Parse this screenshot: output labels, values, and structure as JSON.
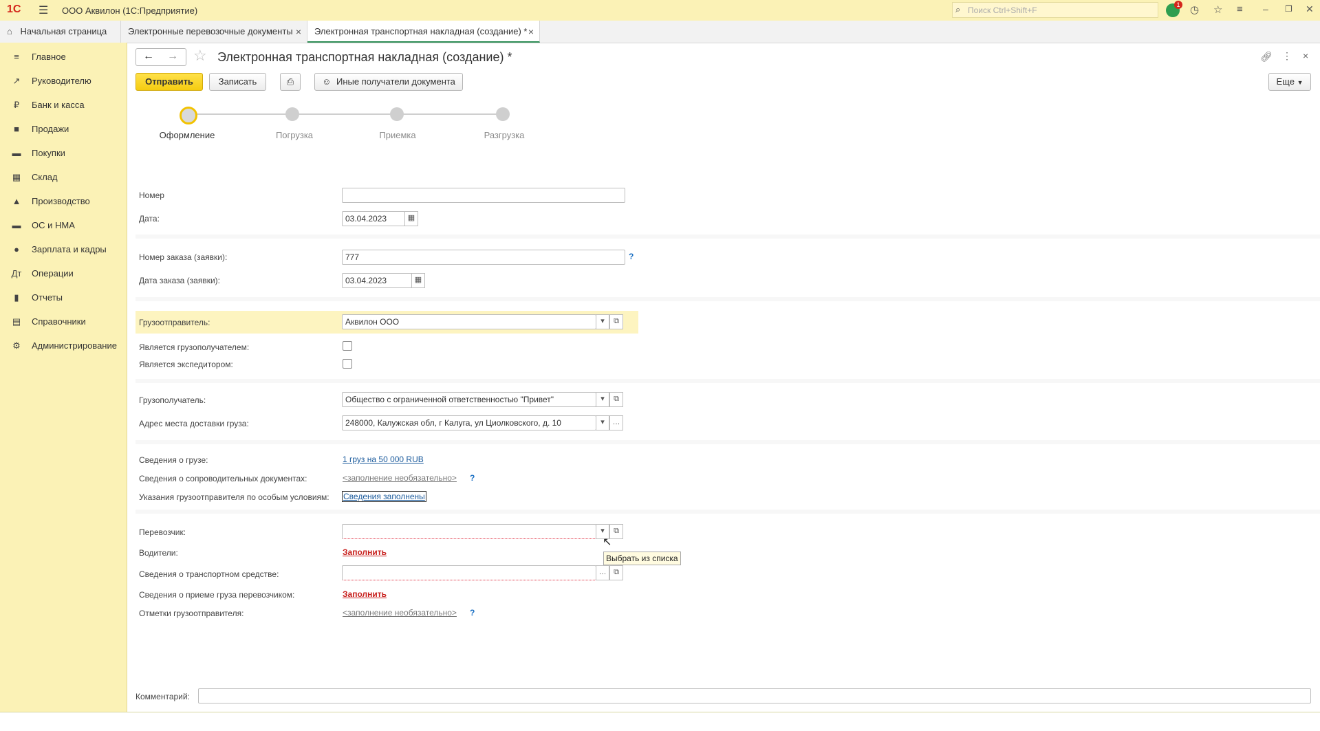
{
  "topbar": {
    "logo": "1С",
    "title": "ООО Аквилон  (1С:Предприятие)",
    "search_placeholder": "Поиск Ctrl+Shift+F",
    "notif_count": "1"
  },
  "tabs": {
    "home": "Начальная страница",
    "tab1": "Электронные перевозочные документы",
    "tab2": "Электронная транспортная накладная (создание) *"
  },
  "sidebar": {
    "items": [
      {
        "label": "Главное",
        "icon": "≡"
      },
      {
        "label": "Руководителю",
        "icon": "↗"
      },
      {
        "label": "Банк и касса",
        "icon": "₽"
      },
      {
        "label": "Продажи",
        "icon": "■"
      },
      {
        "label": "Покупки",
        "icon": "▬"
      },
      {
        "label": "Склад",
        "icon": "▦"
      },
      {
        "label": "Производство",
        "icon": "▲"
      },
      {
        "label": "ОС и НМА",
        "icon": "▬"
      },
      {
        "label": "Зарплата и кадры",
        "icon": "●"
      },
      {
        "label": "Операции",
        "icon": "Дт"
      },
      {
        "label": "Отчеты",
        "icon": "▮"
      },
      {
        "label": "Справочники",
        "icon": "▤"
      },
      {
        "label": "Администрирование",
        "icon": "⚙"
      }
    ]
  },
  "doc": {
    "title": "Электронная транспортная накладная (создание) *",
    "send": "Отправить",
    "save": "Записать",
    "other_recipients": "Иные получатели документа",
    "more": "Еще"
  },
  "steps": [
    "Оформление",
    "Погрузка",
    "Приемка",
    "Разгрузка"
  ],
  "form": {
    "number_label": "Номер",
    "number_value": "",
    "date_label": "Дата:",
    "date_value": "03.04.2023",
    "order_number_label": "Номер заказа (заявки):",
    "order_number_value": "777",
    "order_date_label": "Дата заказа (заявки):",
    "order_date_value": "03.04.2023",
    "shipper_label": "Грузоотправитель:",
    "shipper_value": "Аквилон ООО",
    "is_consignee_label": "Является грузополучателем:",
    "is_forwarder_label": "Является экспедитором:",
    "consignee_label": "Грузополучатель:",
    "consignee_value": "Общество с ограниченной ответственностью \"Привет\"",
    "address_label": "Адрес места доставки груза:",
    "address_value": "248000, Калужская обл, г Калуга, ул Циолковского, д. 10",
    "cargo_label": "Сведения о грузе:",
    "cargo_link": "1 груз на 50 000 RUB",
    "docs_label": "Сведения о сопроводительных документах:",
    "docs_link": "<заполнение необязательно>",
    "special_label": "Указания грузоотправителя по особым условиям:",
    "special_link": "Сведения заполнены",
    "carrier_label": "Перевозчик:",
    "carrier_value": "",
    "drivers_label": "Водители:",
    "drivers_link": "Заполнить",
    "vehicle_label": "Сведения о транспортном средстве:",
    "vehicle_value": "",
    "acceptance_label": "Сведения о приеме груза перевозчиком:",
    "acceptance_link": "Заполнить",
    "marks_label": "Отметки грузоотправителя:",
    "marks_link": "<заполнение необязательно>",
    "comment_label": "Комментарий:",
    "comment_value": ""
  },
  "tooltip": "Выбрать из списка"
}
